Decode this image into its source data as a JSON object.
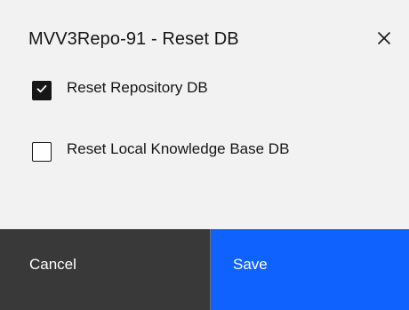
{
  "dialog": {
    "title": "MVV3Repo-91 - Reset DB",
    "close_icon": "close-icon"
  },
  "options": [
    {
      "label": "Reset Repository DB",
      "checked": true
    },
    {
      "label": "Reset Local Knowledge Base DB",
      "checked": false
    }
  ],
  "footer": {
    "cancel_label": "Cancel",
    "save_label": "Save"
  },
  "colors": {
    "background": "#f2f2f2",
    "text": "#161616",
    "cancel_bg": "#393939",
    "save_bg": "#0f62fe"
  }
}
